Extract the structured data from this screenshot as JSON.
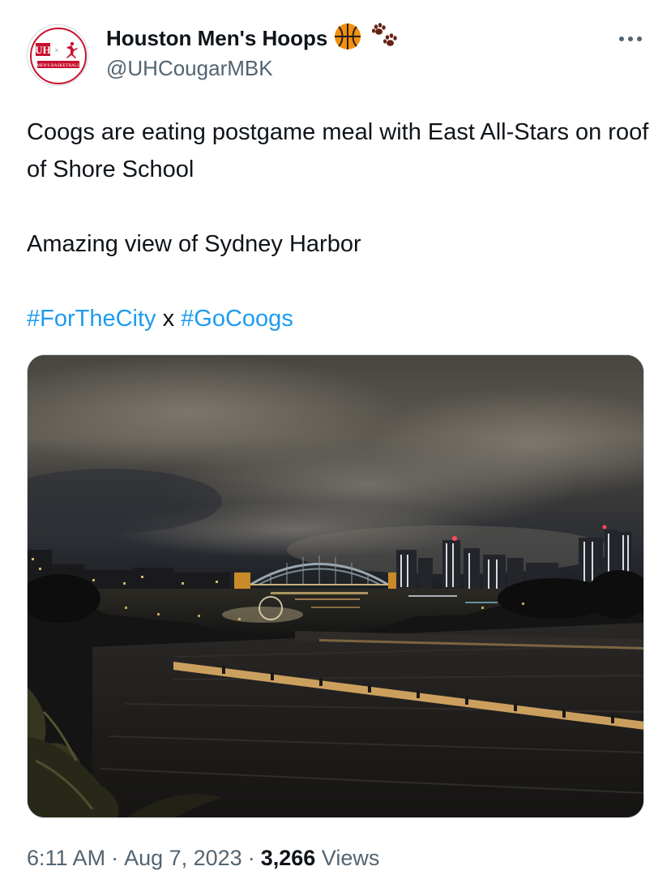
{
  "author": {
    "display_name": "Houston Men's Hoops",
    "handle": "@UHCougarMBK",
    "emojis": [
      "basketball-emoji",
      "paw-prints-emoji"
    ],
    "avatar": {
      "logo_text": "UH",
      "caption": "MEN'S BASKETBALL",
      "accent_color": "#c8102e"
    }
  },
  "tweet": {
    "line1": "Coogs are eating postgame meal with East All-Stars on roof of Shore School",
    "line2": "Amazing view of Sydney Harbor",
    "hashtag1": "#ForTheCity",
    "connector": "x",
    "hashtag2": "#GoCoogs"
  },
  "media": {
    "icon": "photo"
  },
  "meta": {
    "time": "6:11 AM",
    "separator": "·",
    "date": "Aug 7, 2023",
    "views_count": "3,266",
    "views_label": "Views"
  },
  "colors": {
    "link": "#1d9bf0",
    "text": "#0f1419",
    "secondary": "#536471",
    "uh_red": "#c8102e"
  }
}
